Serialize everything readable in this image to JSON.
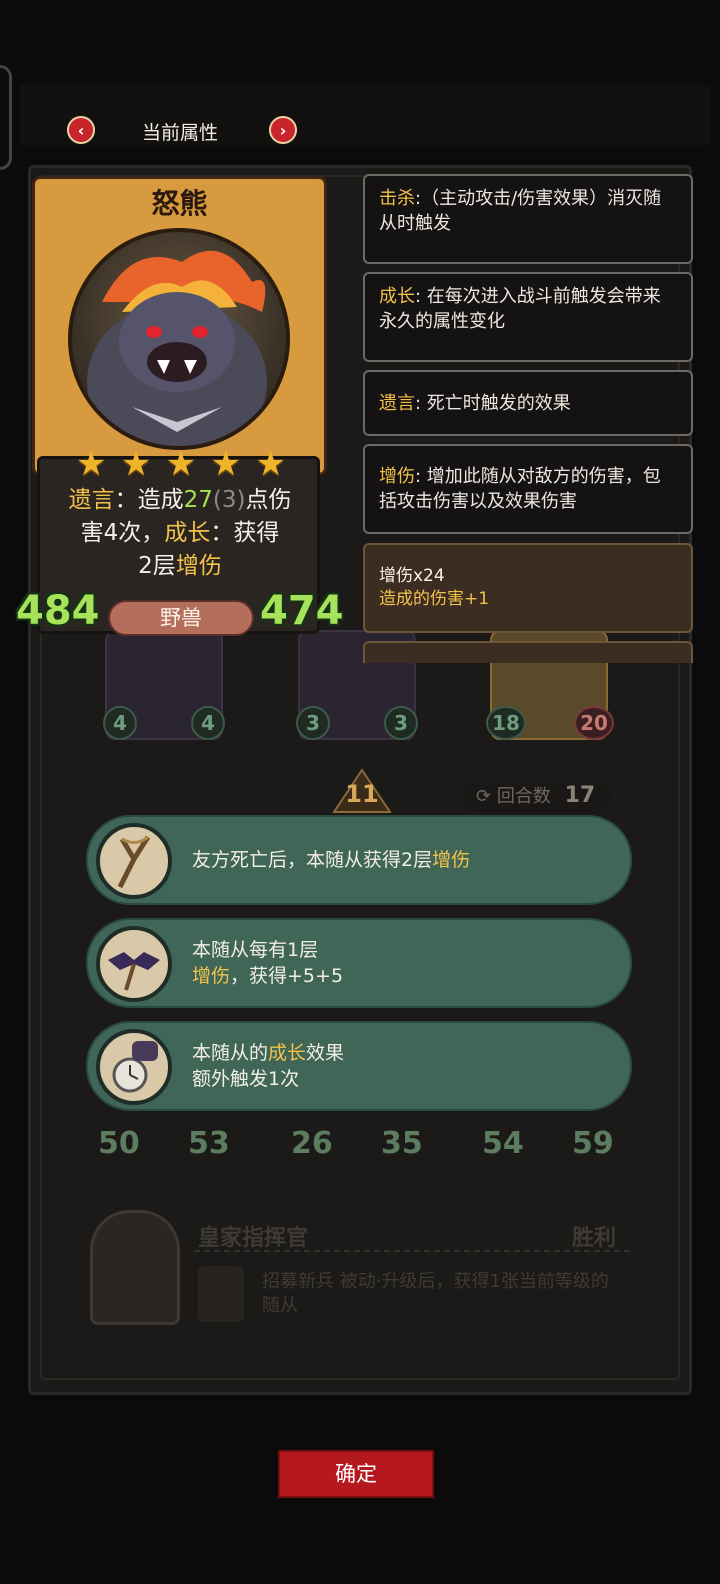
{
  "header": {
    "title": "当前属性",
    "prev_icon": "chevron-left-icon",
    "next_icon": "chevron-right-icon"
  },
  "card": {
    "name": "怒熊",
    "stars": 5,
    "desc": {
      "t1": "遗言",
      "t2": "：造成",
      "t3": "27",
      "t4": "(3)",
      "t5": "点伤",
      "t6": "害4次，",
      "t7": "成长",
      "t8": "：获得",
      "t9": "2层",
      "t10": "增伤"
    },
    "attack": "484",
    "health": "474",
    "tribe": "野兽"
  },
  "tips": [
    {
      "kw": "击杀",
      "text": ":（主动攻击/伤害效果）消灭随从时触发"
    },
    {
      "kw": "成长",
      "text": ": 在每次进入战斗前触发会带来永久的属性变化"
    },
    {
      "kw": "遗言",
      "text": ": 死亡时触发的效果"
    },
    {
      "kw": "增伤",
      "text": ": 增加此随从对敌方的伤害，包括攻击伤害以及效果伤害"
    }
  ],
  "buff": {
    "name": "增伤x24",
    "effect": "造成的伤害+1"
  },
  "board": {
    "rank": "11",
    "rounds_label": "回合数",
    "rounds_value": "17",
    "row1": [
      {
        "atk": "4",
        "hp": "4"
      },
      {
        "atk": "3",
        "hp": "3"
      },
      {
        "atk": "18",
        "hp": "20"
      }
    ],
    "row2": [
      {
        "atk": "50",
        "hp": "53"
      },
      {
        "atk": "26",
        "hp": "35"
      },
      {
        "atk": "54",
        "hp": "59"
      }
    ],
    "commander_name": "皇家指挥官",
    "commander_result": "胜利",
    "commander_skill": "招募新兵 被动·升级后，获得1张当前等级的随从"
  },
  "relics": [
    {
      "line1a": "友方死亡后，本随从获得2层",
      "line1b": "增伤",
      "line2a": "",
      "line2b": "",
      "icon": "slingshot-icon"
    },
    {
      "line1a": "本随从每有1层",
      "line1b": "",
      "line2a": "增伤",
      "line2b": "，获得+5+5",
      "icon": "bat-icon"
    },
    {
      "line1a": "本随从的",
      "line1b": "成长",
      "line1c": "效果",
      "line2a": "额外触发1次",
      "icon": "clock-hand-icon"
    }
  ],
  "confirm_label": "确定"
}
